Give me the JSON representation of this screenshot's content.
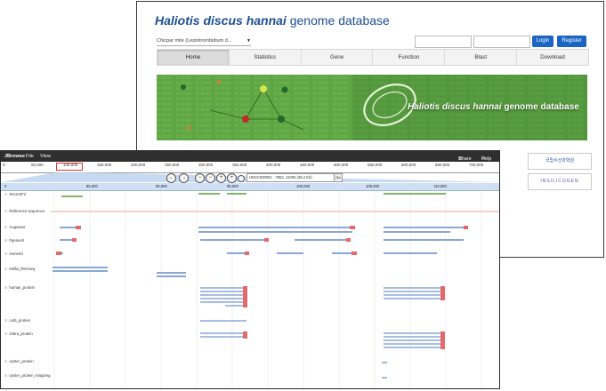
{
  "site": {
    "title_italic": "Haliotis discus hannai",
    "title_rest": " genome database",
    "species_select": "Chicpar mite (Leptotrombidium d...",
    "login_label": "Login",
    "register_label": "Register",
    "nav": [
      "Home",
      "Statistics",
      "Gene",
      "Function",
      "Blast",
      "Download"
    ],
    "active_nav": "Home",
    "banner_title_italic": "Haliotis discus hannai",
    "banner_title_rest": " genome database",
    "partner1": "국립수산과학원",
    "partner2": "INSILICOGEN",
    "colors": {
      "brand": "#1d4f93",
      "button": "#1a64c4",
      "banner": "#5fa544"
    }
  },
  "jbrowse": {
    "app_name": "JBrowse",
    "menu": [
      "File",
      "View"
    ],
    "share_label": "Share",
    "help_label": "Help",
    "overview_ticks": [
      "0",
      "50,000",
      "100,000",
      "150,000",
      "200,000",
      "250,000",
      "300,000",
      "350,000",
      "400,000",
      "450,000",
      "500,000",
      "550,000",
      "600,000",
      "650,000",
      "700,000"
    ],
    "location": "HDSC000001 : 7852..11005 (36.4 Kb)",
    "go_label": "Go",
    "scale_ticks": [
      "0",
      "85,000",
      "90,000",
      "95,000",
      "100,000",
      "105,000",
      "110,000"
    ],
    "tracks": [
      "SG4A2F2",
      "Reference sequence",
      "Augustus",
      "Fgenesh",
      "Generid",
      "Inbfla_RNAseq",
      "human_protein",
      "Lotti_protein",
      "zebra_protein",
      "oyster_protein",
      "oyster_protein_mapping"
    ],
    "colors": {
      "header": "#2f2f2f",
      "scale": "#cfe0f6",
      "feature": "#8aa7d8",
      "feature_end": "#e46a6a",
      "gene": "#5a9a3a"
    }
  }
}
